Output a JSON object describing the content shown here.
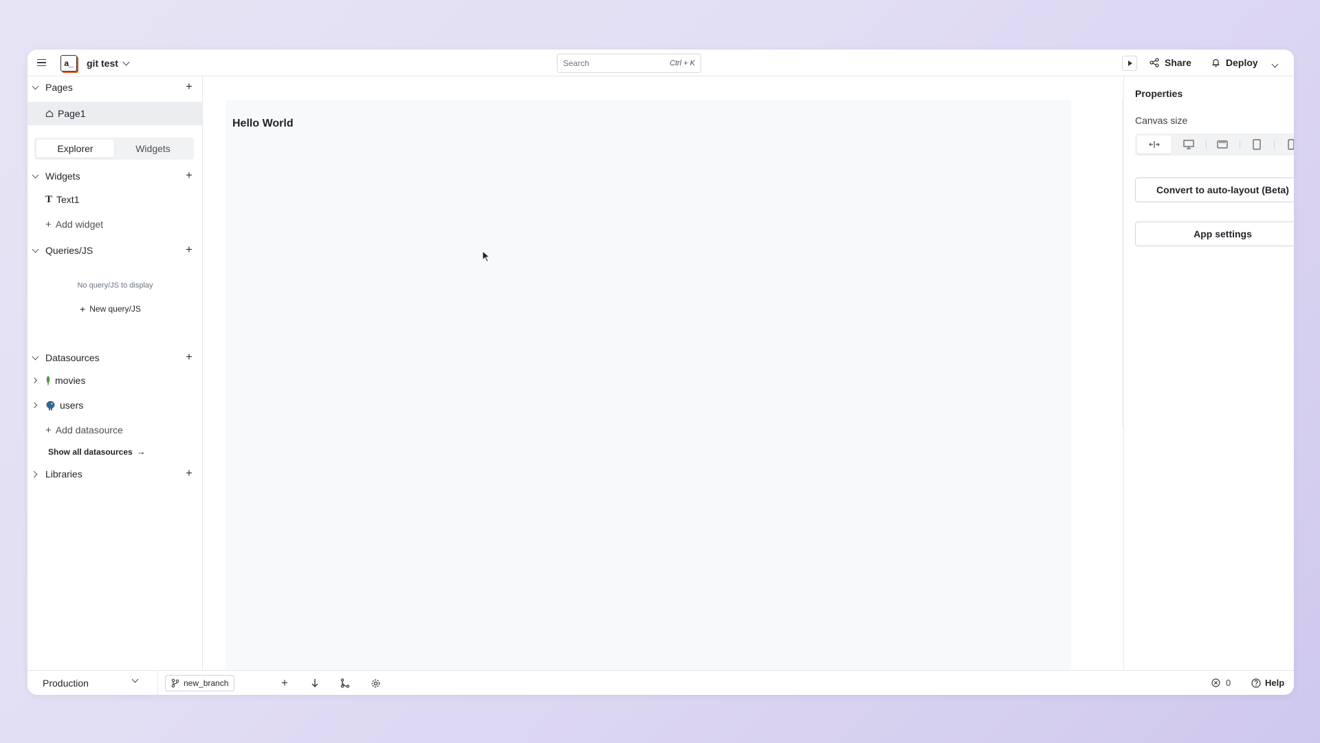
{
  "header": {
    "app_logo_text": "a_",
    "app_name": "git test",
    "search_placeholder": "Search",
    "search_shortcut": "Ctrl + K",
    "share_label": "Share",
    "deploy_label": "Deploy"
  },
  "sidebar": {
    "pages_title": "Pages",
    "pages": [
      {
        "label": "Page1"
      }
    ],
    "tabs": [
      {
        "label": "Explorer",
        "active": true
      },
      {
        "label": "Widgets",
        "active": false
      }
    ],
    "widgets_title": "Widgets",
    "widgets": [
      {
        "label": "Text1",
        "icon": "text-icon"
      }
    ],
    "add_widget_label": "Add widget",
    "queries_title": "Queries/JS",
    "queries_empty": "No query/JS to display",
    "new_query_label": "New query/JS",
    "datasources_title": "Datasources",
    "datasources": [
      {
        "label": "movies",
        "icon": "mongodb-leaf-icon"
      },
      {
        "label": "users",
        "icon": "postgres-elephant-icon"
      }
    ],
    "add_datasource_label": "Add datasource",
    "show_all_label": "Show all datasources",
    "libraries_title": "Libraries"
  },
  "canvas": {
    "text_widget_content": "Hello World"
  },
  "properties": {
    "title": "Properties",
    "canvas_size_label": "Canvas size",
    "size_options": [
      "fluid-width-icon",
      "desktop-icon",
      "tablet-landscape-icon",
      "tablet-portrait-icon",
      "mobile-icon"
    ],
    "convert_label": "Convert to auto-layout (Beta)",
    "app_settings_label": "App settings"
  },
  "footer": {
    "environment": "Production",
    "branch": "new_branch",
    "error_count": "0",
    "help_label": "Help"
  },
  "colors": {
    "brand_accent": "#e15615",
    "mongodb_green": "#4a9a3d",
    "postgres_blue": "#336791"
  }
}
